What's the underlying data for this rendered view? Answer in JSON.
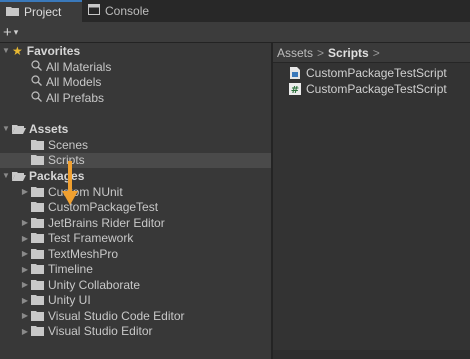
{
  "tabs": [
    {
      "label": "Project",
      "icon": "folder-icon"
    },
    {
      "label": "Console",
      "icon": "console-icon"
    }
  ],
  "toolbar": {
    "plus": "+",
    "caret": "▾"
  },
  "tree": {
    "favorites": {
      "label": "Favorites",
      "items": [
        "All Materials",
        "All Models",
        "All Prefabs"
      ]
    },
    "assets": {
      "label": "Assets",
      "items": [
        "Scenes",
        "Scripts"
      ],
      "selected": "Scripts"
    },
    "packages": {
      "label": "Packages",
      "items": [
        "Custom NUnit",
        "CustomPackageTest",
        "JetBrains Rider Editor",
        "Test Framework",
        "TextMeshPro",
        "Timeline",
        "Unity Collaborate",
        "Unity UI",
        "Visual Studio Code Editor",
        "Visual Studio Editor"
      ]
    }
  },
  "breadcrumb": {
    "root": "Assets",
    "current": "Scripts",
    "sep": ">"
  },
  "files": [
    {
      "name": "CustomPackageTestScript",
      "icon": "asmdef-icon"
    },
    {
      "name": "CustomPackageTestScript",
      "icon": "csharp-script-icon"
    }
  ],
  "colors": {
    "accent": "#3a79bb",
    "cursor": "#f0a030",
    "folder": "#c8c8c8",
    "star": "#e8b832"
  }
}
